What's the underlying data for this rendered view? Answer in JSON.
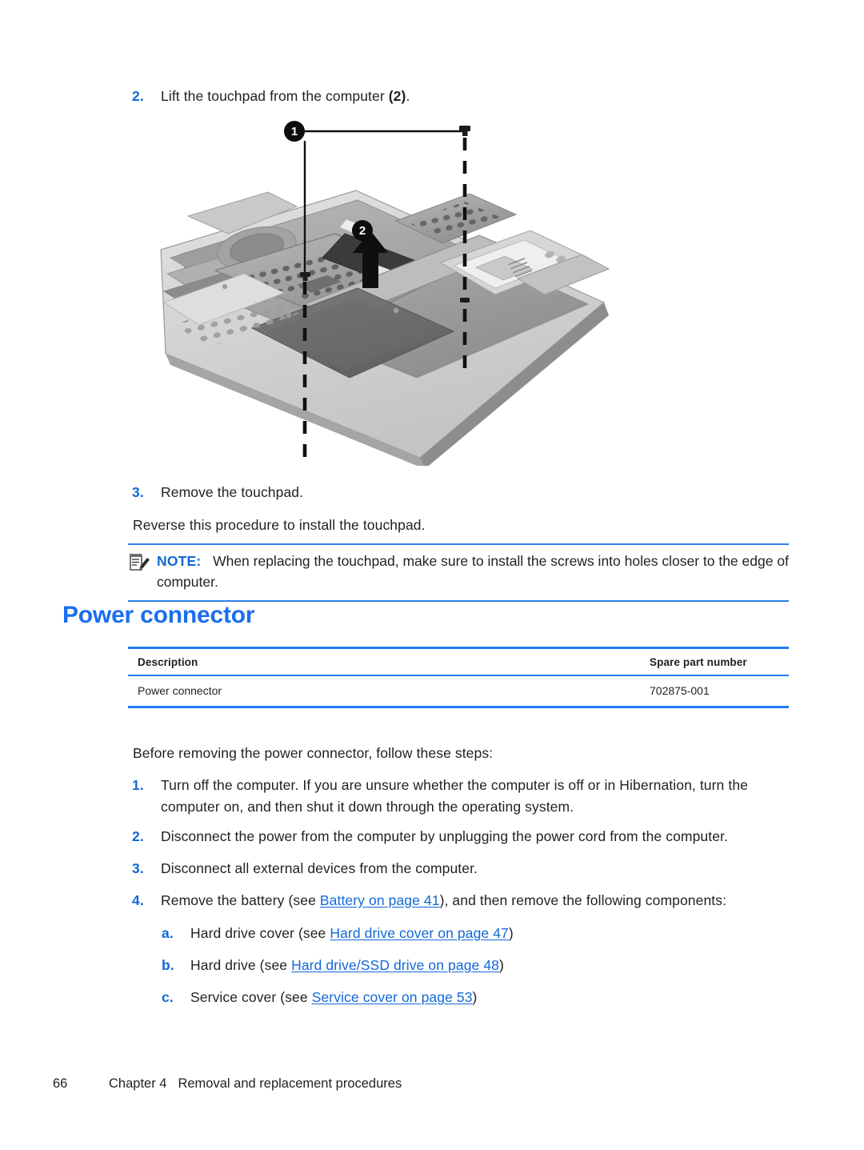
{
  "document": {
    "type": "service-manual-page",
    "accent_blue": "#1a6ef0",
    "rule_blue": "#1f7af0",
    "text_color": "#231f20"
  },
  "steps_top": [
    {
      "marker": "2.",
      "text_before": "Lift the touchpad from the computer ",
      "text_bold": "(2)",
      "text_after": "."
    },
    {
      "marker": "3.",
      "text_before": "Remove the touchpad.",
      "text_bold": "",
      "text_after": ""
    }
  ],
  "reverse_paragraph": "Reverse this procedure to install the touchpad.",
  "figure": {
    "name": "touchpad-removal-illustration",
    "alt": "Grayscale photo of laptop base enclosure with touchpad being lifted",
    "callouts": [
      {
        "label": "1",
        "meaning": "touchpad screws"
      },
      {
        "label": "2",
        "meaning": "lift touchpad"
      }
    ],
    "icon_names": [
      "screw-icon",
      "dashed-guide-line",
      "up-arrow-icon"
    ]
  },
  "note": {
    "icon": "note-pad-pencil-icon",
    "label": "NOTE:",
    "text": "When replacing the touchpad, make sure to install the screws into holes closer to the edge of computer."
  },
  "section": {
    "heading": "Power connector"
  },
  "spec_table": {
    "columns": [
      "Description",
      "Spare part number"
    ],
    "rows": [
      {
        "description": "Power connector",
        "spare_part_number": "702875-001"
      }
    ]
  },
  "intro_paragraph": "Before removing the power connector, follow these steps:",
  "procedure_steps": [
    {
      "marker": "1.",
      "segments": [
        {
          "kind": "text",
          "value": "Turn off the computer. If you are unsure whether the computer is off or in Hibernation, turn the computer on, and then shut it down through the operating system."
        }
      ]
    },
    {
      "marker": "2.",
      "segments": [
        {
          "kind": "text",
          "value": "Disconnect the power from the computer by unplugging the power cord from the computer."
        }
      ]
    },
    {
      "marker": "3.",
      "segments": [
        {
          "kind": "text",
          "value": "Disconnect all external devices from the computer."
        }
      ]
    },
    {
      "marker": "4.",
      "segments": [
        {
          "kind": "text",
          "value": "Remove the battery (see "
        },
        {
          "kind": "link",
          "value": "Battery on page 41"
        },
        {
          "kind": "text",
          "value": "), and then remove the following components:"
        }
      ]
    }
  ],
  "substeps": [
    {
      "marker": "a.",
      "lead": "Hard drive cover (see ",
      "link": "Hard drive cover on page 47",
      "tail": ")"
    },
    {
      "marker": "b.",
      "lead": "Hard drive (see ",
      "link": "Hard drive/SSD drive on page 48",
      "tail": ")"
    },
    {
      "marker": "c.",
      "lead": "Service cover (see ",
      "link": "Service cover on page 53",
      "tail": ")"
    }
  ],
  "footer": {
    "page_number": "66",
    "chapter": "Chapter 4",
    "title": "Removal and replacement procedures"
  }
}
